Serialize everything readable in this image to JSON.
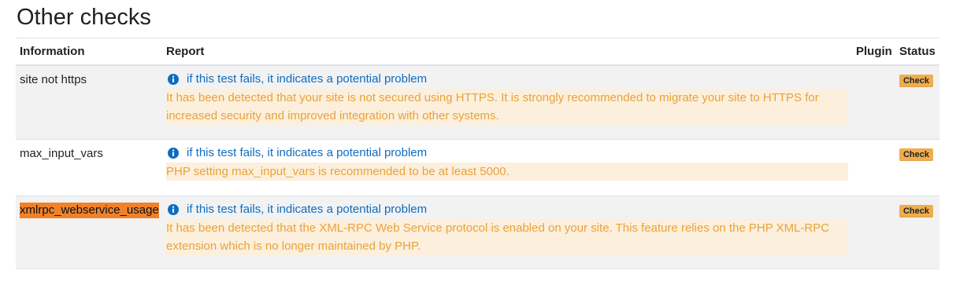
{
  "section": {
    "title": "Other checks"
  },
  "table": {
    "headers": {
      "information": "Information",
      "report": "Report",
      "plugin": "Plugin",
      "status": "Status"
    },
    "rows": [
      {
        "information": "site not https",
        "link": "if this test fails, it indicates a potential problem",
        "message": "It has been detected that your site is not secured using HTTPS. It is strongly recommended to migrate your site to HTTPS for increased security and improved integration with other systems.",
        "plugin": "",
        "status": "Check"
      },
      {
        "information": "max_input_vars",
        "link": "if this test fails, it indicates a potential problem",
        "message": "PHP setting max_input_vars is recommended to be at least 5000.",
        "plugin": "",
        "status": "Check"
      },
      {
        "information": "xmlrpc_webservice_usage",
        "link": "if this test fails, it indicates a potential problem",
        "message": "It has been detected that the XML-RPC Web Service protocol is enabled on your site. This feature relies on the PHP XML-RPC extension which is no longer maintained by PHP.",
        "plugin": "",
        "status": "Check"
      }
    ]
  },
  "icons": {
    "report_link_icon": "info-circle-icon"
  },
  "colors": {
    "link": "#0f6cbf",
    "warning_text": "#e8a33b",
    "warning_bg": "#fcefdc",
    "badge_bg": "#f0ad4e",
    "highlight": "#f0822a",
    "row_alt_bg": "#f2f2f2"
  }
}
